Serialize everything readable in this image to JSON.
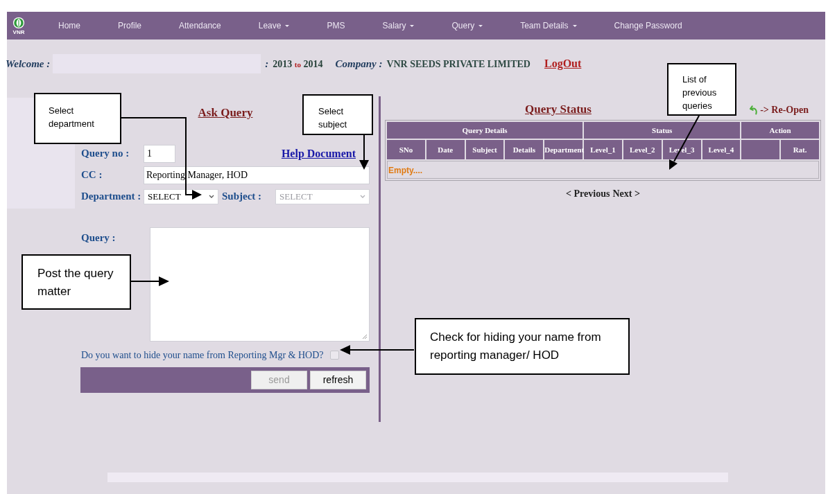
{
  "nav": {
    "logo_text": "VNR",
    "items": [
      {
        "label": "Home",
        "dropdown": false
      },
      {
        "label": "Profile",
        "dropdown": false
      },
      {
        "label": "Attendance",
        "dropdown": false
      },
      {
        "label": "Leave",
        "dropdown": true
      },
      {
        "label": "PMS",
        "dropdown": false
      },
      {
        "label": "Salary",
        "dropdown": true
      },
      {
        "label": "Query",
        "dropdown": true
      },
      {
        "label": "Team Details",
        "dropdown": true
      },
      {
        "label": "Change Password",
        "dropdown": false
      }
    ]
  },
  "welcome": {
    "label": "Welcome :",
    "separator": ":",
    "year_from": "2013",
    "year_joiner": "to",
    "year_to": "2014",
    "company_label": "Company :",
    "company": "VNR SEEDS PRIVATE LIMITED",
    "logout": "LogOut"
  },
  "ask_query": {
    "title": "Ask Query",
    "help_link": "Help Document",
    "query_no": {
      "label": "Query no :",
      "value": "1"
    },
    "cc": {
      "label": "CC :",
      "value": "Reporting Manager, HOD"
    },
    "department": {
      "label": "Department :",
      "value": "SELECT",
      "disabled": false
    },
    "subject": {
      "label": "Subject :",
      "value": "SELECT",
      "disabled": true
    },
    "query": {
      "label": "Query :"
    },
    "hide_name": {
      "label": "Do you want to hide your name from Reporting Mgr & HOD?",
      "checked": false
    },
    "buttons": [
      {
        "label": "send",
        "disabled": true
      },
      {
        "label": "refresh",
        "disabled": false
      }
    ]
  },
  "query_status": {
    "title": "Query Status",
    "reopen": "-> Re-Open",
    "table": {
      "groups": [
        {
          "label": "Query Details"
        },
        {
          "label": "Status"
        },
        {
          "label": "Action"
        }
      ],
      "columns": [
        "SNo",
        "Date",
        "Subject",
        "Details",
        "Department",
        "Level_1",
        "Level_2",
        "Level_3",
        "Level_4",
        "",
        "Rat."
      ],
      "empty": "Empty...."
    },
    "pagination": [
      "< Previous",
      "Next >"
    ]
  },
  "annotations": [
    {
      "text": "Select department"
    },
    {
      "text": "Select subject"
    },
    {
      "text": "List of previous queries"
    },
    {
      "text": "Post the query matter"
    },
    {
      "text": "Check for hiding your name from reporting manager/ HOD"
    }
  ]
}
